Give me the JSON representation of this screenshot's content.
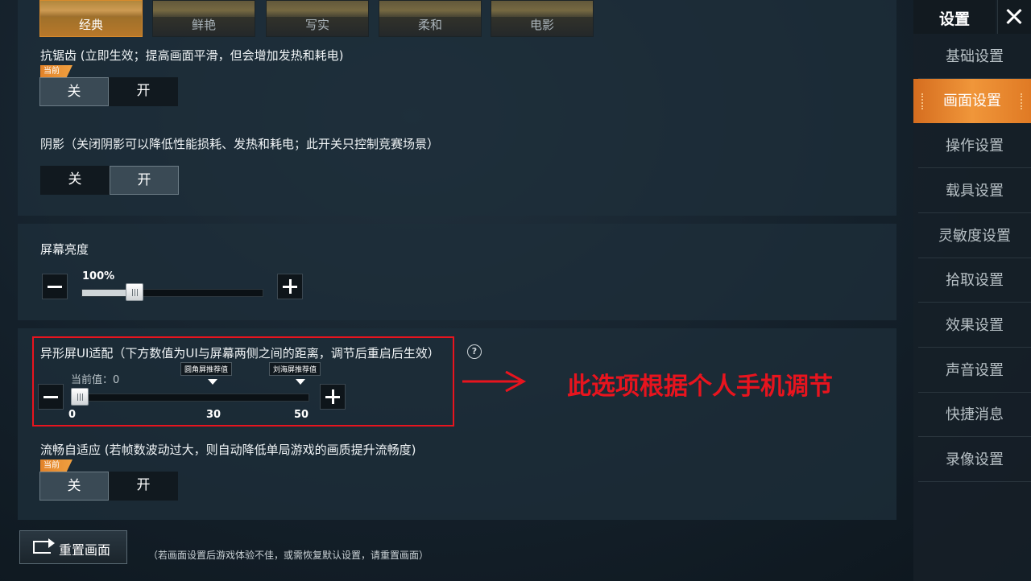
{
  "presets": [
    "经典",
    "鲜艳",
    "写实",
    "柔和",
    "电影"
  ],
  "antialias": {
    "title": "抗锯齿 (立即生效；提高画面平滑，但会增加发热和耗电)",
    "badge": "当前",
    "off": "关",
    "on": "开"
  },
  "shadow": {
    "title": "阴影（关闭阴影可以降低性能损耗、发热和耗电；此开关只控制竞赛场景）",
    "off": "关",
    "on": "开"
  },
  "brightness": {
    "title": "屏幕亮度",
    "value_label": "100%",
    "value": 0.29
  },
  "notch": {
    "title": "异形屏UI适配（下方数值为UI与屏幕两侧之间的距离，调节后重启后生效）",
    "current_label": "当前值：0",
    "tag_round": "圆角屏推荐值",
    "tag_notch": "刘海屏推荐值",
    "tick_min": "0",
    "tick_mid": "30",
    "tick_max": "50",
    "value": 0
  },
  "annotation": {
    "text": "此选项根据个人手机调节",
    "color": "#e8141e"
  },
  "smooth": {
    "title": "流畅自适应 (若帧数波动过大，则自动降低单局游戏的画质提升流畅度)",
    "badge": "当前",
    "off": "关",
    "on": "开"
  },
  "reset": {
    "label": "重置画面",
    "hint": "（若画面设置后游戏体验不佳，或需恢复默认设置，请重置画面）"
  },
  "sidebar": {
    "title": "设置",
    "items": [
      "基础设置",
      "画面设置",
      "操作设置",
      "载具设置",
      "灵敏度设置",
      "拾取设置",
      "效果设置",
      "声音设置",
      "快捷消息",
      "录像设置"
    ]
  },
  "colors": {
    "accent": "#f0963a",
    "annotation": "#e8141e"
  }
}
